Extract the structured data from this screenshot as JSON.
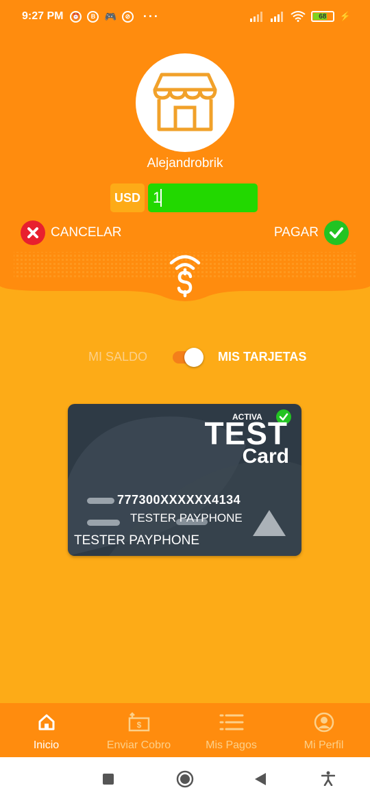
{
  "status_bar": {
    "time": "9:27 PM",
    "left_icons": [
      "alarm-icon",
      "b-icon",
      "game-icon",
      "no-disturb-icon"
    ],
    "battery": "68"
  },
  "merchant": {
    "name": "Alejandrobrik",
    "icon": "store-icon"
  },
  "payment": {
    "currency": "USD",
    "amount": "1",
    "cancel_label": "CANCELAR",
    "pay_label": "PAGAR"
  },
  "source_toggle": {
    "left_label": "MI SALDO",
    "right_label": "MIS TARJETAS",
    "selected": "MIS TARJETAS"
  },
  "card": {
    "status": "ACTIVA",
    "brand_line1": "TEST",
    "brand_line2": "Card",
    "number": "777300XXXXXX4134",
    "holder_small": "TESTER PAYPHONE",
    "holder": "TESTER PAYPHONE"
  },
  "bottom_nav": {
    "items": [
      {
        "label": "Inicio",
        "icon": "home-icon",
        "active": true
      },
      {
        "label": "Enviar Cobro",
        "icon": "send-charge-icon",
        "active": false
      },
      {
        "label": "Mis Pagos",
        "icon": "list-icon",
        "active": false
      },
      {
        "label": "Mi Perfil",
        "icon": "profile-icon",
        "active": false
      }
    ]
  },
  "colors": {
    "background": "#FDAB17",
    "header": "#FF8C0E",
    "amount_field": "#22D800",
    "cancel": "#E8202E",
    "confirm": "#22C322",
    "card": "#2E3A45"
  }
}
